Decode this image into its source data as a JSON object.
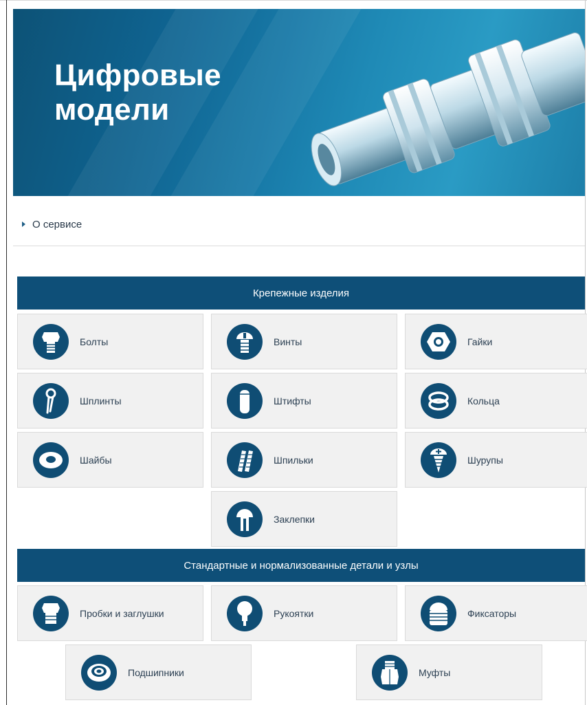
{
  "banner": {
    "title_line1": "Цифровые",
    "title_line2": "модели"
  },
  "nav": {
    "service_link": "О сервисе"
  },
  "sections": [
    {
      "title": "Крепежные изделия",
      "items": [
        {
          "label": "Болты",
          "icon": "bolt-icon"
        },
        {
          "label": "Винты",
          "icon": "screw-icon"
        },
        {
          "label": "Гайки",
          "icon": "nut-icon"
        },
        {
          "label": "Шплинты",
          "icon": "cotter-pin-icon"
        },
        {
          "label": "Штифты",
          "icon": "pin-icon"
        },
        {
          "label": "Кольца",
          "icon": "ring-icon"
        },
        {
          "label": "Шайбы",
          "icon": "washer-icon"
        },
        {
          "label": "Шпильки",
          "icon": "stud-icon"
        },
        {
          "label": "Шурупы",
          "icon": "wood-screw-icon"
        },
        {
          "label": "Заклепки",
          "icon": "rivet-icon"
        }
      ]
    },
    {
      "title": "Стандартные и нормализованные детали и узлы",
      "items": [
        {
          "label": "Пробки и заглушки",
          "icon": "plug-icon"
        },
        {
          "label": "Рукоятки",
          "icon": "handle-icon"
        },
        {
          "label": "Фиксаторы",
          "icon": "retainer-icon"
        },
        {
          "label": "Подшипники",
          "icon": "bearing-icon"
        },
        {
          "label": "Муфты",
          "icon": "coupling-icon"
        }
      ]
    }
  ],
  "colors": {
    "accent": "#0e4f78",
    "tile_bg": "#f1f1f1",
    "banner": "#1778a6"
  }
}
